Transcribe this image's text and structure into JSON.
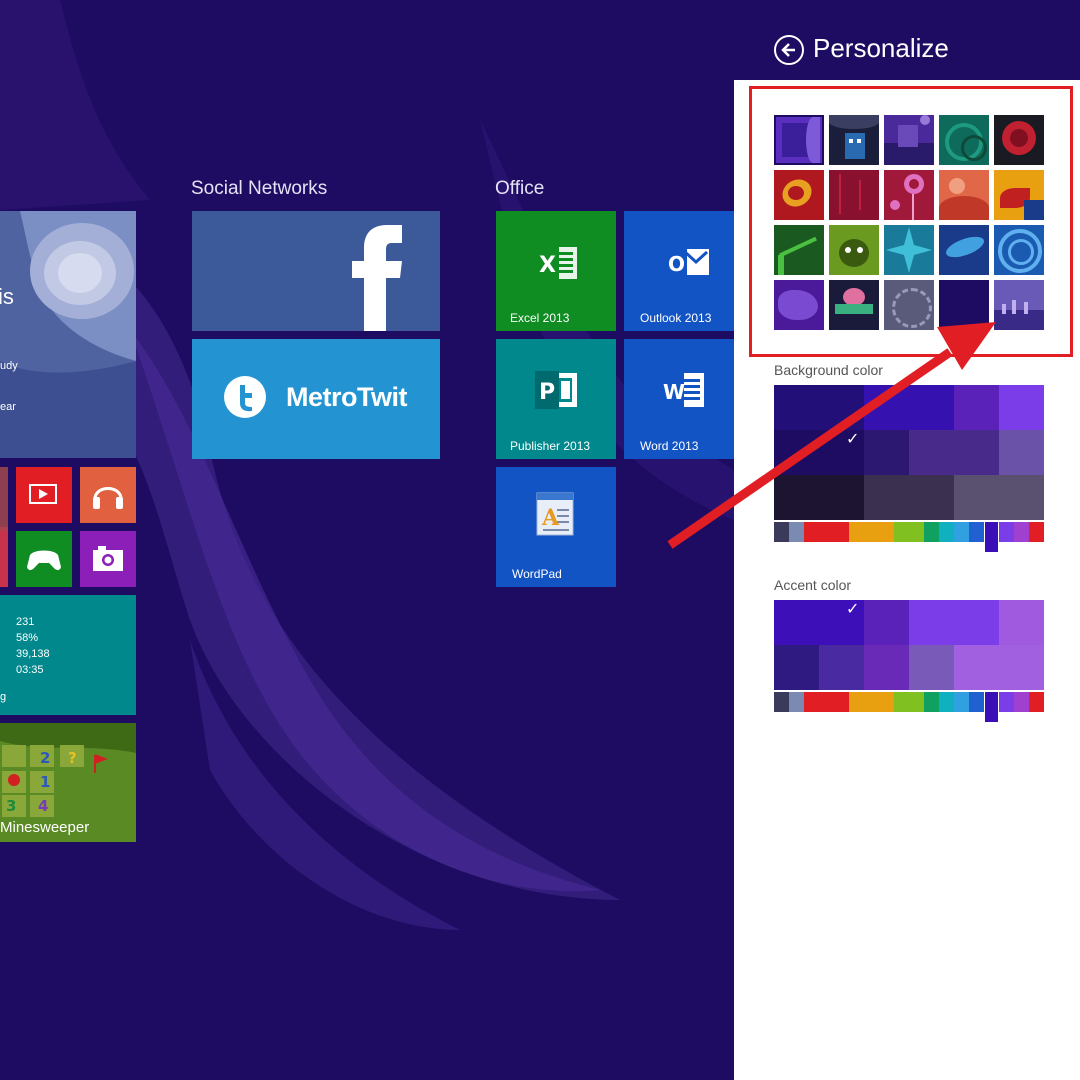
{
  "start_screen": {
    "groups": {
      "social": "Social Networks",
      "office": "Office"
    },
    "weather_tile": {
      "partial_text_1": "is",
      "partial_text_2": "udy",
      "partial_text_3": "ear"
    },
    "tiles": {
      "facebook": {
        "label": ""
      },
      "metrotwit": {
        "label": "MetroTwit"
      },
      "excel": {
        "label": "Excel 2013"
      },
      "outlook": {
        "label": "Outlook 2013"
      },
      "publisher": {
        "label": "Publisher 2013"
      },
      "word": {
        "label": "Word 2013"
      },
      "wordpad": {
        "label": "WordPad"
      },
      "stats": {
        "values": [
          "231",
          "58%",
          "39,138",
          "03:35"
        ],
        "partial_label": "g"
      },
      "minesweeper": {
        "label": "Minesweeper"
      }
    }
  },
  "personalize": {
    "title": "Personalize",
    "background_color_label": "Background color",
    "accent_color_label": "Accent color",
    "selected_background": "#1e0c62",
    "selected_accent": "#3d0fb8"
  },
  "colors": {
    "desktop_bg": "#1e0c62",
    "highlight_red": "#e01e24",
    "excel_green": "#0f8c22",
    "outlook_blue": "#1354c4",
    "publisher_teal": "#00888c",
    "word_blue": "#1354c4",
    "facebook_blue": "#3c5a9a",
    "metrotwit_blue": "#2394d1"
  }
}
